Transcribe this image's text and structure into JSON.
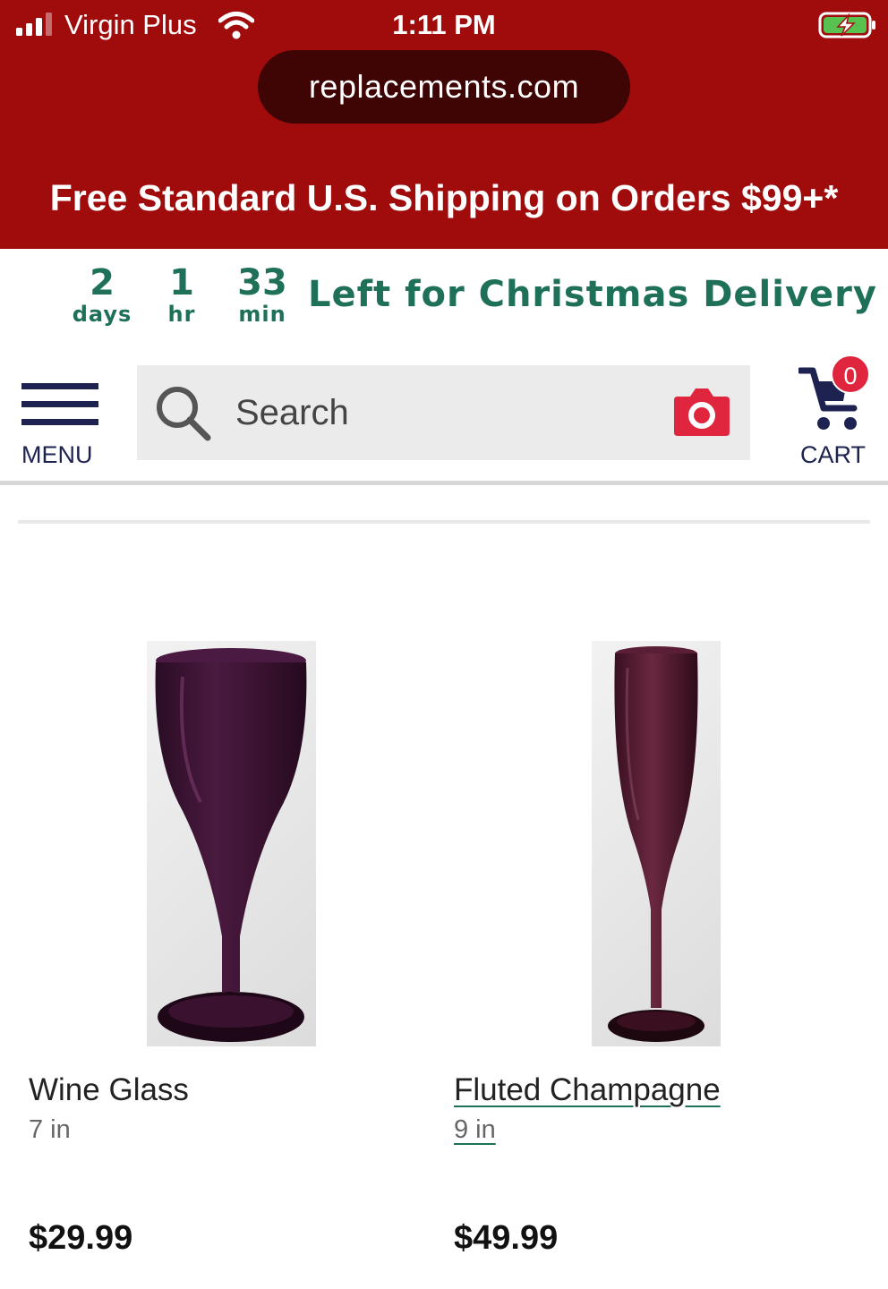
{
  "status_bar": {
    "carrier": "Virgin Plus",
    "time": "1:11 PM"
  },
  "browser": {
    "url": "replacements.com"
  },
  "promo": {
    "text": "Free Standard U.S. Shipping on Orders $99+*"
  },
  "countdown": {
    "days_value": "2",
    "days_label": "days",
    "hours_value": "1",
    "hours_label": "hr",
    "minutes_value": "33",
    "minutes_label": "min",
    "message": "Left for Christmas Delivery"
  },
  "header": {
    "menu_label": "MENU",
    "search_placeholder": "Search",
    "cart_label": "CART",
    "cart_count": "0"
  },
  "products": [
    {
      "name": "Wine Glass",
      "size": "7 in",
      "price": "$29.99",
      "image_icon": "wine-glass-icon"
    },
    {
      "name": "Fluted Champagne",
      "size": "9 in",
      "price": "$49.99",
      "image_icon": "champagne-flute-icon"
    }
  ],
  "colors": {
    "brand_red": "#a00b0c",
    "url_pill": "#3f0404",
    "countdown_green": "#1f7058",
    "navy": "#1e2250",
    "camera_red": "#e0263f",
    "glass_purple": "#3a1230"
  }
}
